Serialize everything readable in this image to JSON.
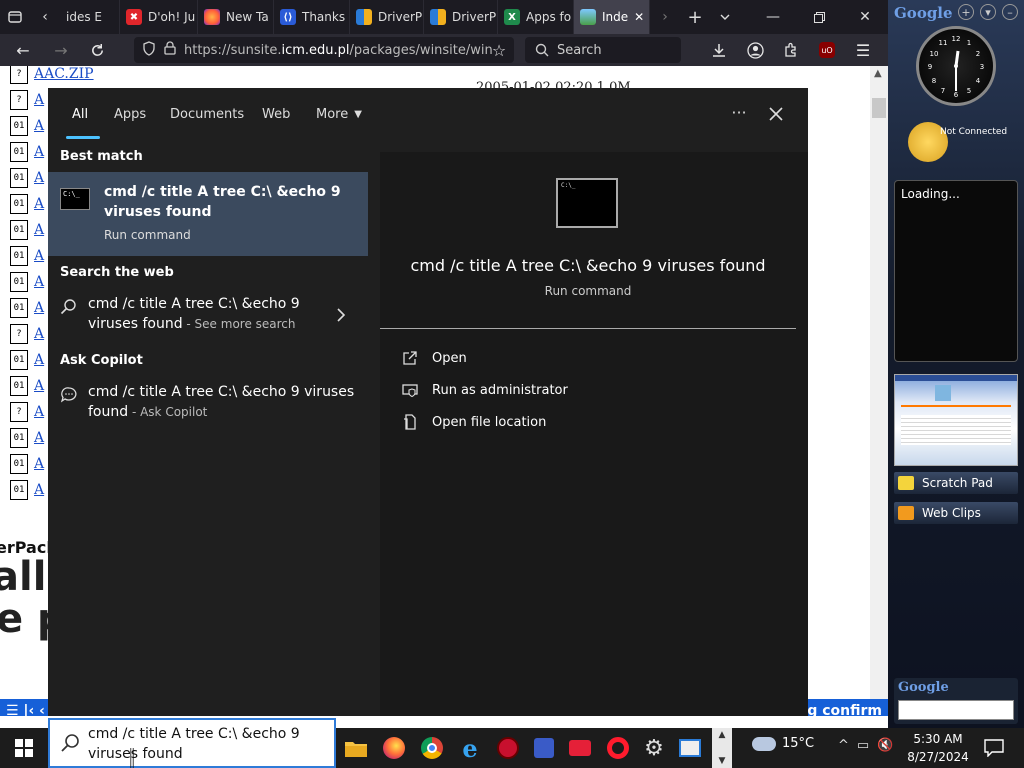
{
  "browser": {
    "tabs": [
      {
        "label": "ides E",
        "fav_color": "#444"
      },
      {
        "label": "D'oh! Ju",
        "fav_color": "#e0262b"
      },
      {
        "label": "New Ta",
        "fav_color": "#ff7139"
      },
      {
        "label": "Thanks",
        "fav_color": "#2a5bd7"
      },
      {
        "label": "DriverP",
        "fav_color": "#f2b01e"
      },
      {
        "label": "DriverP",
        "fav_color": "#f2b01e"
      },
      {
        "label": "Apps fo",
        "fav_color": "#1f8a4c"
      },
      {
        "label": "Inde",
        "fav_color": "#4aa04a"
      }
    ],
    "url_prefix": "https://sunsite.",
    "url_host": "icm.edu.pl",
    "url_rest": "/packages/winsite/win",
    "search_placeholder": "Search",
    "addon_badge": "uO"
  },
  "page": {
    "files": [
      {
        "icon": "?",
        "name": "AAC.ZIP"
      },
      {
        "icon": "?",
        "name": "A"
      },
      {
        "icon": "01",
        "name": "A"
      },
      {
        "icon": "01",
        "name": "A"
      },
      {
        "icon": "01",
        "name": "A"
      },
      {
        "icon": "01",
        "name": "A"
      },
      {
        "icon": "01",
        "name": "A"
      },
      {
        "icon": "01",
        "name": "A"
      },
      {
        "icon": "01",
        "name": "A"
      },
      {
        "icon": "01",
        "name": "A"
      },
      {
        "icon": "?",
        "name": "A"
      },
      {
        "icon": "01",
        "name": "A"
      },
      {
        "icon": "01",
        "name": "A"
      },
      {
        "icon": "?",
        "name": "A"
      },
      {
        "icon": "01",
        "name": "A"
      },
      {
        "icon": "01",
        "name": "A"
      },
      {
        "icon": "01",
        "name": "A"
      }
    ],
    "top_row_date": "2005-01-02 02:20  1.0M",
    "big_text_1": "erPack",
    "big_text_2": "alli",
    "big_text_3": "e pr",
    "bottom_bar_right": "ng confirm",
    "bottom_bar_left": "☰ |‹ ‹"
  },
  "sidebar": {
    "logo": "Google",
    "weather_status": "Not Connected",
    "loading": "Loading...",
    "scratch_pad": "Scratch Pad",
    "web_clips": "Web Clips",
    "search_logo": "Google"
  },
  "flyout": {
    "tabs": [
      "All",
      "Apps",
      "Documents",
      "Web",
      "More"
    ],
    "best_match_header": "Best match",
    "best_match": {
      "title": "cmd /c title A tree C:\\ &echo 9 viruses found",
      "subtitle": "Run command"
    },
    "search_web_header": "Search the web",
    "web_result": {
      "text": "cmd /c title A tree C:\\ &echo 9 viruses found",
      "sub": " - See more search"
    },
    "copilot_header": "Ask Copilot",
    "copilot_result": {
      "text": "cmd /c title A tree C:\\ &echo 9 viruses found",
      "sub": " - Ask Copilot"
    },
    "preview": {
      "title": "cmd /c title A tree C:\\ &echo 9 viruses found",
      "subtitle": "Run command",
      "icon_prompt": "C:\\_"
    },
    "actions": [
      {
        "label": "Open",
        "icon": "open-icon"
      },
      {
        "label": "Run as administrator",
        "icon": "shield-admin-icon"
      },
      {
        "label": "Open file location",
        "icon": "file-location-icon"
      }
    ]
  },
  "taskbar": {
    "search_text": "cmd /c title A tree C:\\ &echo 9 viruses found",
    "temperature": "15°C",
    "time": "5:30 AM",
    "date": "8/27/2024"
  }
}
